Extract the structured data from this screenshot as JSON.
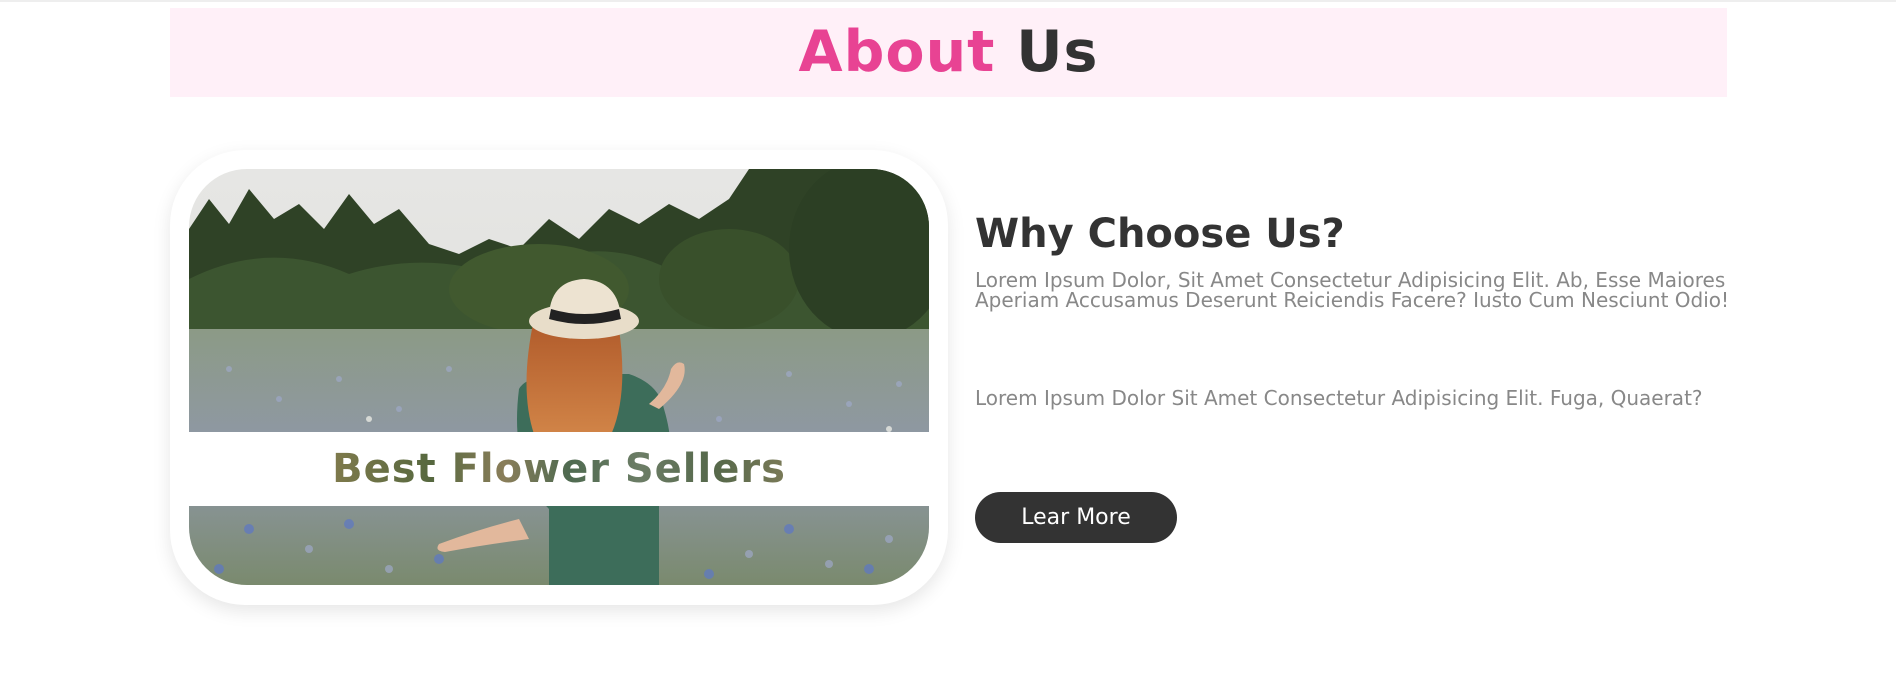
{
  "header": {
    "title_accent": "About",
    "title_main": "Us",
    "accent_color": "#e84393",
    "banner_color": "#fff0f8"
  },
  "image_card": {
    "caption": "Best Flower Sellers"
  },
  "content": {
    "heading": "Why Choose Us?",
    "paragraph_1": "Lorem Ipsum Dolor, Sit Amet Consectetur Adipisicing Elit. Ab, Esse Maiores Aperiam Accusamus Deserunt Reiciendis Facere? Iusto Cum Nesciunt Odio!",
    "paragraph_2": "Lorem Ipsum Dolor Sit Amet Consectetur Adipisicing Elit. Fuga, Quaerat?",
    "button_label": "Lear More",
    "button_color": "#333333"
  }
}
